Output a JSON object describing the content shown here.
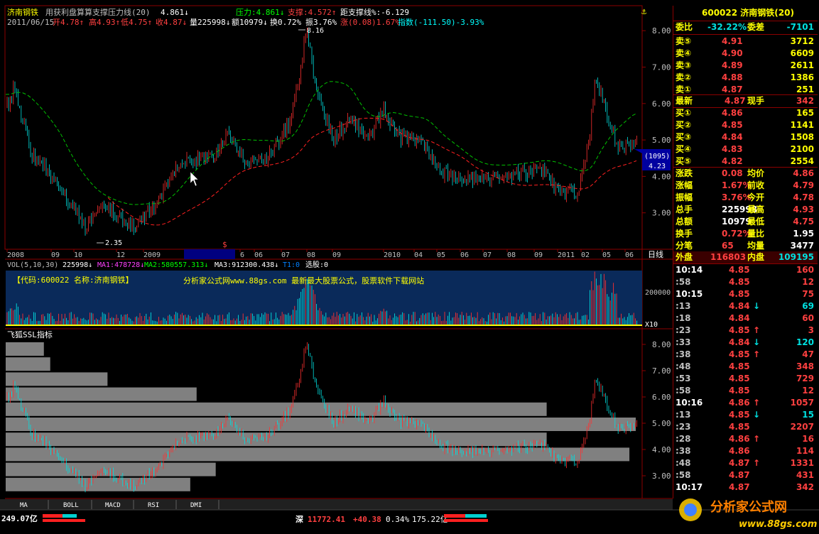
{
  "header": {
    "stock_name": "济南钢铁",
    "indicator_title": "用获利盘算算支撑压力线(20)",
    "indicator_value": "4.861↓",
    "pressure": "压力:4.861↓",
    "support": "支撑:4.572↑",
    "distance": "距支撑线%:-6.129",
    "date": "2011/06/15",
    "open": "开4.78↑",
    "high": "高4.93↑",
    "low": "低4.75↑",
    "close": "收4.87↓",
    "volume": "量225998↓",
    "amount": "额10979↓",
    "turnover": "换0.72%",
    "amplitude": "振3.76%",
    "change": "涨(0.08)1.67%",
    "index": "指数(-111.50)-3.93%"
  },
  "price_axis": [
    "8.00",
    "7.00",
    "6.00",
    "5.00",
    "4.00",
    "3.00"
  ],
  "annotations": {
    "high": "8.16",
    "low": "2.35",
    "cursor_date": "09/03/10,二",
    "price_tag": "(1095)",
    "price_tag_value": "4.23",
    "marker": "$"
  },
  "time_axis": [
    "2008",
    "09",
    "10",
    "12",
    "2009",
    "09/03/10,二",
    "6",
    "06",
    "07",
    "08",
    "09",
    "2010",
    "04",
    "05",
    "06",
    "07",
    "08",
    "09",
    "2011",
    "02",
    "05",
    "06"
  ],
  "period_label": "日线",
  "vol_header": {
    "label": "VOL(5,10,30)",
    "v0": "225998↓",
    "ma1": "MA1:478728↓",
    "ma2": "MA2:580557.313↓",
    "ma3": "MA3:912300.438↓",
    "t1": "T1:0",
    "select": "选股:0"
  },
  "vol_panel": {
    "code_label": "【代码:600022 名称:济南钢铁】",
    "ad": "分析家公式网www.88gs.com 最新最大股票公式，股票软件下载网站",
    "axis_value": "200000",
    "unit": "X10"
  },
  "ssl_panel": {
    "title": "飞狐SSL指标",
    "axis": [
      "8.00",
      "7.00",
      "6.00",
      "5.00",
      "4.00",
      "3.00"
    ],
    "bars": [
      0.06,
      0.07,
      0.16,
      0.3,
      0.85,
      0.99,
      0.85,
      0.98,
      0.33,
      0.29
    ]
  },
  "tabs": [
    "MA",
    "BOLL",
    "MACD",
    "RSI",
    "DMI"
  ],
  "status": {
    "left": "249.07亿",
    "index_name": "深",
    "index_value": "11772.41",
    "index_change": "+40.38",
    "index_pct": "0.34%",
    "amount": "175.22亿",
    "logo": "分析家公式网",
    "logo_url": "www.88gs.com"
  },
  "quote": {
    "title": "600022 济南钢铁(20)",
    "webi": {
      "label": "委比",
      "value": "-32.22%",
      "label2": "委差",
      "value2": "-7101"
    },
    "asks": [
      {
        "label": "卖⑤",
        "price": "4.91",
        "vol": "3712"
      },
      {
        "label": "卖④",
        "price": "4.90",
        "vol": "6609"
      },
      {
        "label": "卖③",
        "price": "4.89",
        "vol": "2611"
      },
      {
        "label": "卖②",
        "price": "4.88",
        "vol": "1386"
      },
      {
        "label": "卖①",
        "price": "4.87",
        "vol": "251"
      }
    ],
    "last": {
      "label": "最新",
      "price": "4.87",
      "label2": "现手",
      "vol": "342"
    },
    "bids": [
      {
        "label": "买①",
        "price": "4.86",
        "vol": "165"
      },
      {
        "label": "买②",
        "price": "4.85",
        "vol": "1141"
      },
      {
        "label": "买③",
        "price": "4.84",
        "vol": "1508"
      },
      {
        "label": "买④",
        "price": "4.83",
        "vol": "2100"
      },
      {
        "label": "买⑤",
        "price": "4.82",
        "vol": "2554"
      }
    ],
    "stats": [
      {
        "l1": "涨跌",
        "v1": "0.08",
        "l2": "均价",
        "v2": "4.86"
      },
      {
        "l1": "涨幅",
        "v1": "1.67%",
        "l2": "前收",
        "v2": "4.79"
      },
      {
        "l1": "振幅",
        "v1": "3.76%",
        "l2": "今开",
        "v2": "4.78"
      },
      {
        "l1": "总手",
        "v1": "225998",
        "l2": "最高",
        "v2": "4.93"
      },
      {
        "l1": "总额",
        "v1": "10979",
        "l2": "最低",
        "v2": "4.75"
      },
      {
        "l1": "换手",
        "v1": "0.72%",
        "l2": "量比",
        "v2": "1.95"
      },
      {
        "l1": "分笔",
        "v1": "65",
        "l2": "均量",
        "v2": "3477"
      }
    ],
    "outer": {
      "label": "外盘",
      "value": "116803",
      "label2": "内盘",
      "value2": "109195"
    },
    "ticks": [
      {
        "t": "10:14",
        "p": "4.85",
        "a": "",
        "v": "160"
      },
      {
        "t": ":58",
        "p": "4.85",
        "a": "",
        "v": "12"
      },
      {
        "t": "10:15",
        "p": "4.85",
        "a": "",
        "v": "75"
      },
      {
        "t": ":13",
        "p": "4.84",
        "a": "↓",
        "v": "69"
      },
      {
        "t": ":18",
        "p": "4.84",
        "a": "",
        "v": "60"
      },
      {
        "t": ":23",
        "p": "4.85",
        "a": "↑",
        "v": "3"
      },
      {
        "t": ":33",
        "p": "4.84",
        "a": "↓",
        "v": "120"
      },
      {
        "t": ":38",
        "p": "4.85",
        "a": "↑",
        "v": "47"
      },
      {
        "t": ":48",
        "p": "4.85",
        "a": "",
        "v": "348"
      },
      {
        "t": ":53",
        "p": "4.85",
        "a": "",
        "v": "729"
      },
      {
        "t": ":58",
        "p": "4.85",
        "a": "",
        "v": "12"
      },
      {
        "t": "10:16",
        "p": "4.86",
        "a": "↑",
        "v": "1057"
      },
      {
        "t": ":13",
        "p": "4.85",
        "a": "↓",
        "v": "15"
      },
      {
        "t": ":23",
        "p": "4.85",
        "a": "",
        "v": "2207"
      },
      {
        "t": ":28",
        "p": "4.86",
        "a": "↑",
        "v": "16"
      },
      {
        "t": ":38",
        "p": "4.86",
        "a": "",
        "v": "114"
      },
      {
        "t": ":48",
        "p": "4.87",
        "a": "↑",
        "v": "1331"
      },
      {
        "t": ":58",
        "p": "4.87",
        "a": "",
        "v": "431"
      },
      {
        "t": "10:17",
        "p": "4.87",
        "a": "",
        "v": "342"
      }
    ]
  }
}
